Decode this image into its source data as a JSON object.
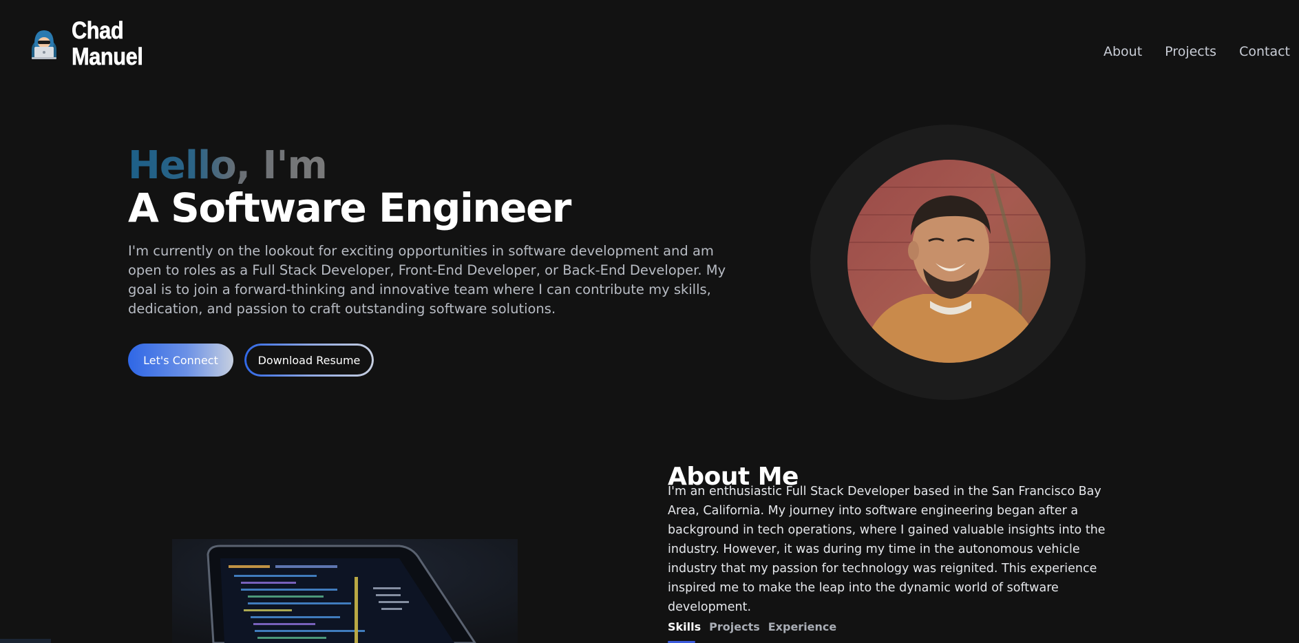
{
  "brand": {
    "name_line1": "Chad",
    "name_line2": "Manuel",
    "logo_icon": "hacker-avatar-icon"
  },
  "nav": {
    "items": [
      {
        "label": "About"
      },
      {
        "label": "Projects"
      },
      {
        "label": "Contact"
      }
    ]
  },
  "hero": {
    "greeting": "Hello, I'm",
    "title": "A Software Engineer",
    "description": "I'm currently on the lookout for exciting opportunities in software development and am open to roles as a Full Stack Developer, Front-End Developer, or Back-End Developer. My goal is to join a forward-thinking and innovative team where I can contribute my skills, dedication, and passion to craft outstanding software solutions.",
    "primary_button": "Let's Connect",
    "secondary_button": "Download Resume",
    "profile_image": "profile-photo"
  },
  "about": {
    "heading": "About Me",
    "body": "I'm an enthusiastic Full Stack Developer based in the San Francisco Bay Area, California. My journey into software engineering began after a background in tech operations, where I gained valuable insights into the industry. However, it was during my time in the autonomous vehicle industry that my passion for technology was reignited. This experience inspired me to make the leap into the dynamic world of software development.",
    "tabs": [
      {
        "label": "Skills",
        "active": true
      },
      {
        "label": "Projects",
        "active": false
      },
      {
        "label": "Experience",
        "active": false
      }
    ],
    "image": "laptop-code-image"
  },
  "colors": {
    "background": "#121212",
    "accent_blue": "#2f67e6",
    "greeting_blue": "#1d5f88",
    "muted_text": "#b8bcc4"
  }
}
